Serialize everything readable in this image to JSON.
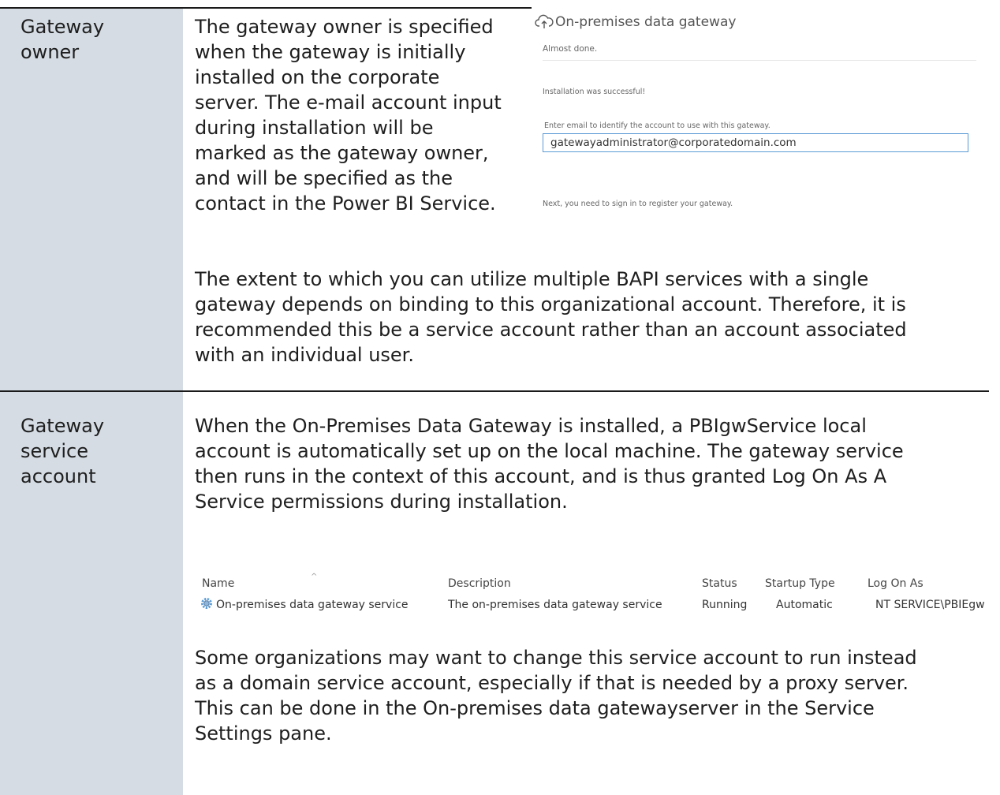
{
  "rows": [
    {
      "label": "Gateway\nowner",
      "paragraphs": [
        "The gateway owner is specified\nwhen the gateway is initially\ninstalled on the corporate\nserver. The e-mail account input\nduring installation will be\nmarked as the gateway owner,\nand will be specified as the\ncontact in the Power BI Service.",
        "The extent to which you can utilize multiple BAPI services with a single\ngateway depends on binding to this organizational account. Therefore, it is\nrecommended this be a service account rather than an account associated\nwith an individual user."
      ]
    },
    {
      "label": "Gateway\nservice\naccount",
      "paragraphs": [
        "When the On-Premises Data Gateway is installed, a PBIgwService local\naccount is automatically set up on the local machine. The gateway service\nthen runs in the context of this account, and is thus granted Log On As A\nService permissions during installation.",
        "Some organizations may want to change this service account to run instead\nas a domain service account, especially if that is needed by a proxy server.\nThis can be done in the On-premises data gatewayserver in the Service\nSettings pane."
      ]
    }
  ],
  "gateway_dialog": {
    "title": "On-premises data gateway",
    "subtitle": "Almost done.",
    "success": "Installation was successful!",
    "email_prompt": "Enter email to identify the account to use with this gateway.",
    "email_value": "gatewayadministrator@corporatedomain.com",
    "next_step": "Next, you need to sign in to register your gateway.",
    "icon": "cloud-upload-icon"
  },
  "services_list": {
    "headers": [
      "Name",
      "Description",
      "Status",
      "Startup Type",
      "Log On As"
    ],
    "row": [
      "On-premises data gateway service",
      "The on-premises data gateway service",
      "Running",
      "Automatic",
      "NT SERVICE\\PBIEgw"
    ],
    "icon": "service-gear-icon",
    "accent": "#5b9bd5"
  }
}
